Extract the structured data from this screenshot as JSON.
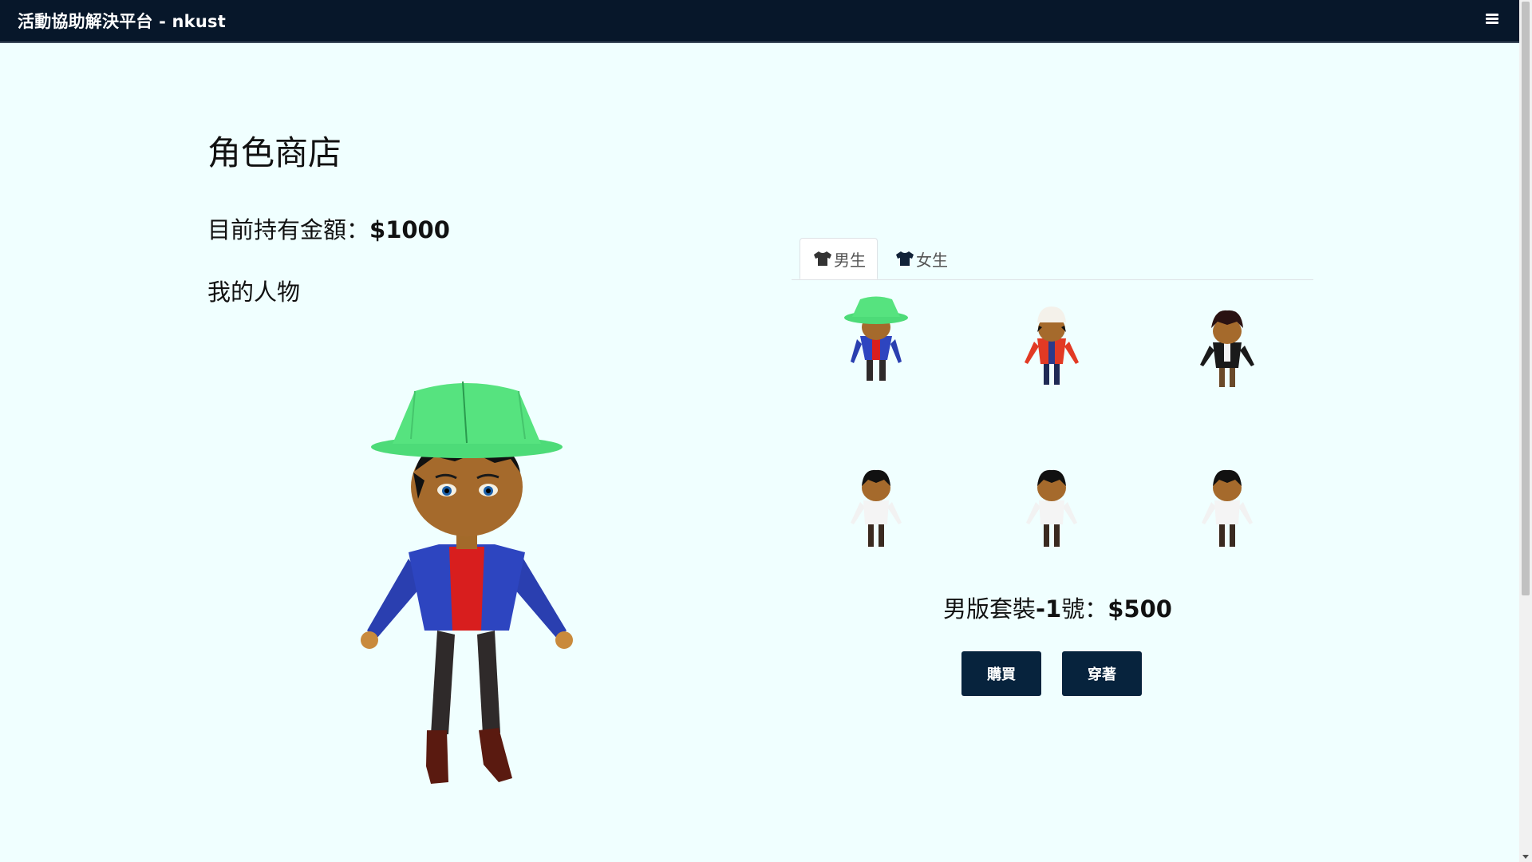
{
  "navbar": {
    "brand": "活動協助解決平台 - nkust",
    "menu_icon": "hamburger-menu-icon"
  },
  "main": {
    "title": "角色商店",
    "balance_label": "目前持有金額：",
    "balance_amount": "$1000",
    "my_character_label": "我的人物"
  },
  "shop": {
    "tabs": [
      {
        "label": "男生",
        "icon": "shirt-icon",
        "active": true
      },
      {
        "label": "女生",
        "icon": "shirt-icon",
        "active": false
      }
    ],
    "outfits": [
      {
        "hat": "green-bucket-hat",
        "jacket": "blue",
        "selected": true
      },
      {
        "hat": "white-cap",
        "jacket": "red"
      },
      {
        "hat": "none",
        "jacket": "black-suit"
      },
      {
        "hat": "none",
        "jacket": "white"
      },
      {
        "hat": "none",
        "jacket": "white"
      },
      {
        "hat": "none",
        "jacket": "white"
      }
    ],
    "selected_name": "男版套裝",
    "selected_number": "-1",
    "selected_suffix": "號：",
    "selected_price": "$500",
    "buy_label": "購買",
    "wear_label": "穿著"
  },
  "colors": {
    "navbar_bg": "#07172a",
    "page_bg": "#f0ffff",
    "button_bg": "#07233d"
  }
}
